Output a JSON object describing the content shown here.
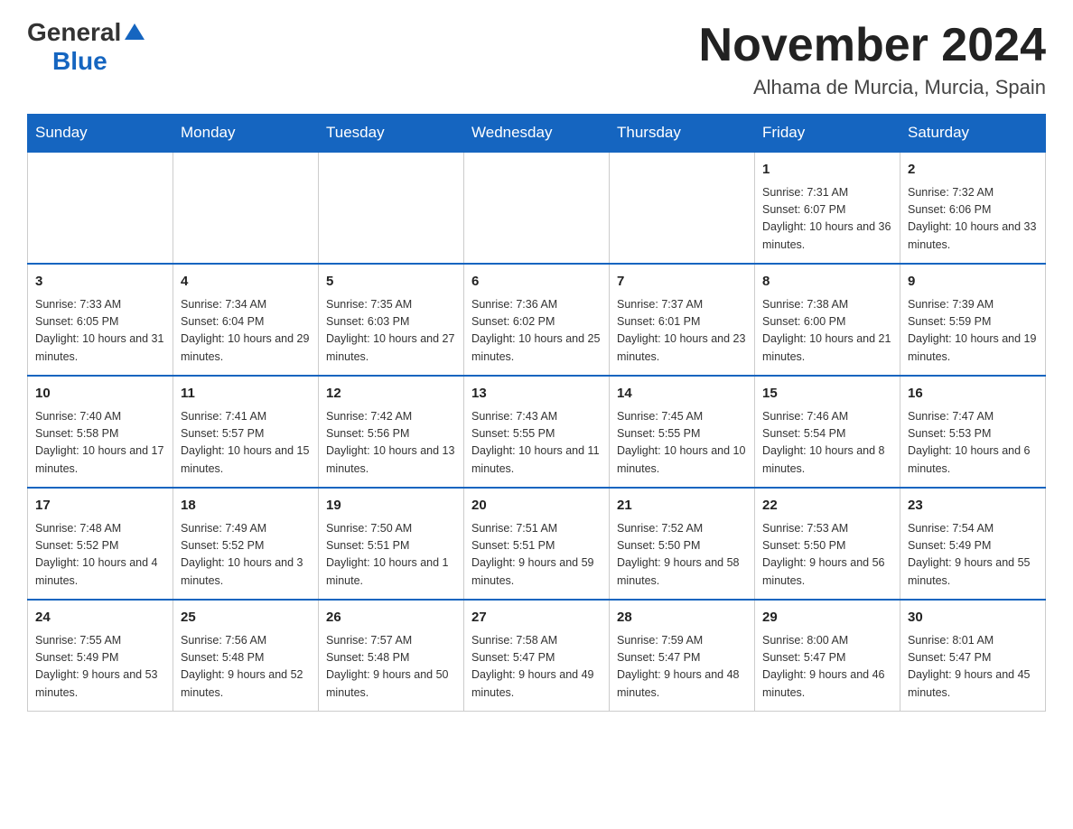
{
  "header": {
    "month_year": "November 2024",
    "location": "Alhama de Murcia, Murcia, Spain"
  },
  "logo": {
    "general": "General",
    "blue": "Blue"
  },
  "weekdays": [
    "Sunday",
    "Monday",
    "Tuesday",
    "Wednesday",
    "Thursday",
    "Friday",
    "Saturday"
  ],
  "weeks": [
    [
      {
        "day": "",
        "info": ""
      },
      {
        "day": "",
        "info": ""
      },
      {
        "day": "",
        "info": ""
      },
      {
        "day": "",
        "info": ""
      },
      {
        "day": "",
        "info": ""
      },
      {
        "day": "1",
        "info": "Sunrise: 7:31 AM\nSunset: 6:07 PM\nDaylight: 10 hours and 36 minutes."
      },
      {
        "day": "2",
        "info": "Sunrise: 7:32 AM\nSunset: 6:06 PM\nDaylight: 10 hours and 33 minutes."
      }
    ],
    [
      {
        "day": "3",
        "info": "Sunrise: 7:33 AM\nSunset: 6:05 PM\nDaylight: 10 hours and 31 minutes."
      },
      {
        "day": "4",
        "info": "Sunrise: 7:34 AM\nSunset: 6:04 PM\nDaylight: 10 hours and 29 minutes."
      },
      {
        "day": "5",
        "info": "Sunrise: 7:35 AM\nSunset: 6:03 PM\nDaylight: 10 hours and 27 minutes."
      },
      {
        "day": "6",
        "info": "Sunrise: 7:36 AM\nSunset: 6:02 PM\nDaylight: 10 hours and 25 minutes."
      },
      {
        "day": "7",
        "info": "Sunrise: 7:37 AM\nSunset: 6:01 PM\nDaylight: 10 hours and 23 minutes."
      },
      {
        "day": "8",
        "info": "Sunrise: 7:38 AM\nSunset: 6:00 PM\nDaylight: 10 hours and 21 minutes."
      },
      {
        "day": "9",
        "info": "Sunrise: 7:39 AM\nSunset: 5:59 PM\nDaylight: 10 hours and 19 minutes."
      }
    ],
    [
      {
        "day": "10",
        "info": "Sunrise: 7:40 AM\nSunset: 5:58 PM\nDaylight: 10 hours and 17 minutes."
      },
      {
        "day": "11",
        "info": "Sunrise: 7:41 AM\nSunset: 5:57 PM\nDaylight: 10 hours and 15 minutes."
      },
      {
        "day": "12",
        "info": "Sunrise: 7:42 AM\nSunset: 5:56 PM\nDaylight: 10 hours and 13 minutes."
      },
      {
        "day": "13",
        "info": "Sunrise: 7:43 AM\nSunset: 5:55 PM\nDaylight: 10 hours and 11 minutes."
      },
      {
        "day": "14",
        "info": "Sunrise: 7:45 AM\nSunset: 5:55 PM\nDaylight: 10 hours and 10 minutes."
      },
      {
        "day": "15",
        "info": "Sunrise: 7:46 AM\nSunset: 5:54 PM\nDaylight: 10 hours and 8 minutes."
      },
      {
        "day": "16",
        "info": "Sunrise: 7:47 AM\nSunset: 5:53 PM\nDaylight: 10 hours and 6 minutes."
      }
    ],
    [
      {
        "day": "17",
        "info": "Sunrise: 7:48 AM\nSunset: 5:52 PM\nDaylight: 10 hours and 4 minutes."
      },
      {
        "day": "18",
        "info": "Sunrise: 7:49 AM\nSunset: 5:52 PM\nDaylight: 10 hours and 3 minutes."
      },
      {
        "day": "19",
        "info": "Sunrise: 7:50 AM\nSunset: 5:51 PM\nDaylight: 10 hours and 1 minute."
      },
      {
        "day": "20",
        "info": "Sunrise: 7:51 AM\nSunset: 5:51 PM\nDaylight: 9 hours and 59 minutes."
      },
      {
        "day": "21",
        "info": "Sunrise: 7:52 AM\nSunset: 5:50 PM\nDaylight: 9 hours and 58 minutes."
      },
      {
        "day": "22",
        "info": "Sunrise: 7:53 AM\nSunset: 5:50 PM\nDaylight: 9 hours and 56 minutes."
      },
      {
        "day": "23",
        "info": "Sunrise: 7:54 AM\nSunset: 5:49 PM\nDaylight: 9 hours and 55 minutes."
      }
    ],
    [
      {
        "day": "24",
        "info": "Sunrise: 7:55 AM\nSunset: 5:49 PM\nDaylight: 9 hours and 53 minutes."
      },
      {
        "day": "25",
        "info": "Sunrise: 7:56 AM\nSunset: 5:48 PM\nDaylight: 9 hours and 52 minutes."
      },
      {
        "day": "26",
        "info": "Sunrise: 7:57 AM\nSunset: 5:48 PM\nDaylight: 9 hours and 50 minutes."
      },
      {
        "day": "27",
        "info": "Sunrise: 7:58 AM\nSunset: 5:47 PM\nDaylight: 9 hours and 49 minutes."
      },
      {
        "day": "28",
        "info": "Sunrise: 7:59 AM\nSunset: 5:47 PM\nDaylight: 9 hours and 48 minutes."
      },
      {
        "day": "29",
        "info": "Sunrise: 8:00 AM\nSunset: 5:47 PM\nDaylight: 9 hours and 46 minutes."
      },
      {
        "day": "30",
        "info": "Sunrise: 8:01 AM\nSunset: 5:47 PM\nDaylight: 9 hours and 45 minutes."
      }
    ]
  ]
}
